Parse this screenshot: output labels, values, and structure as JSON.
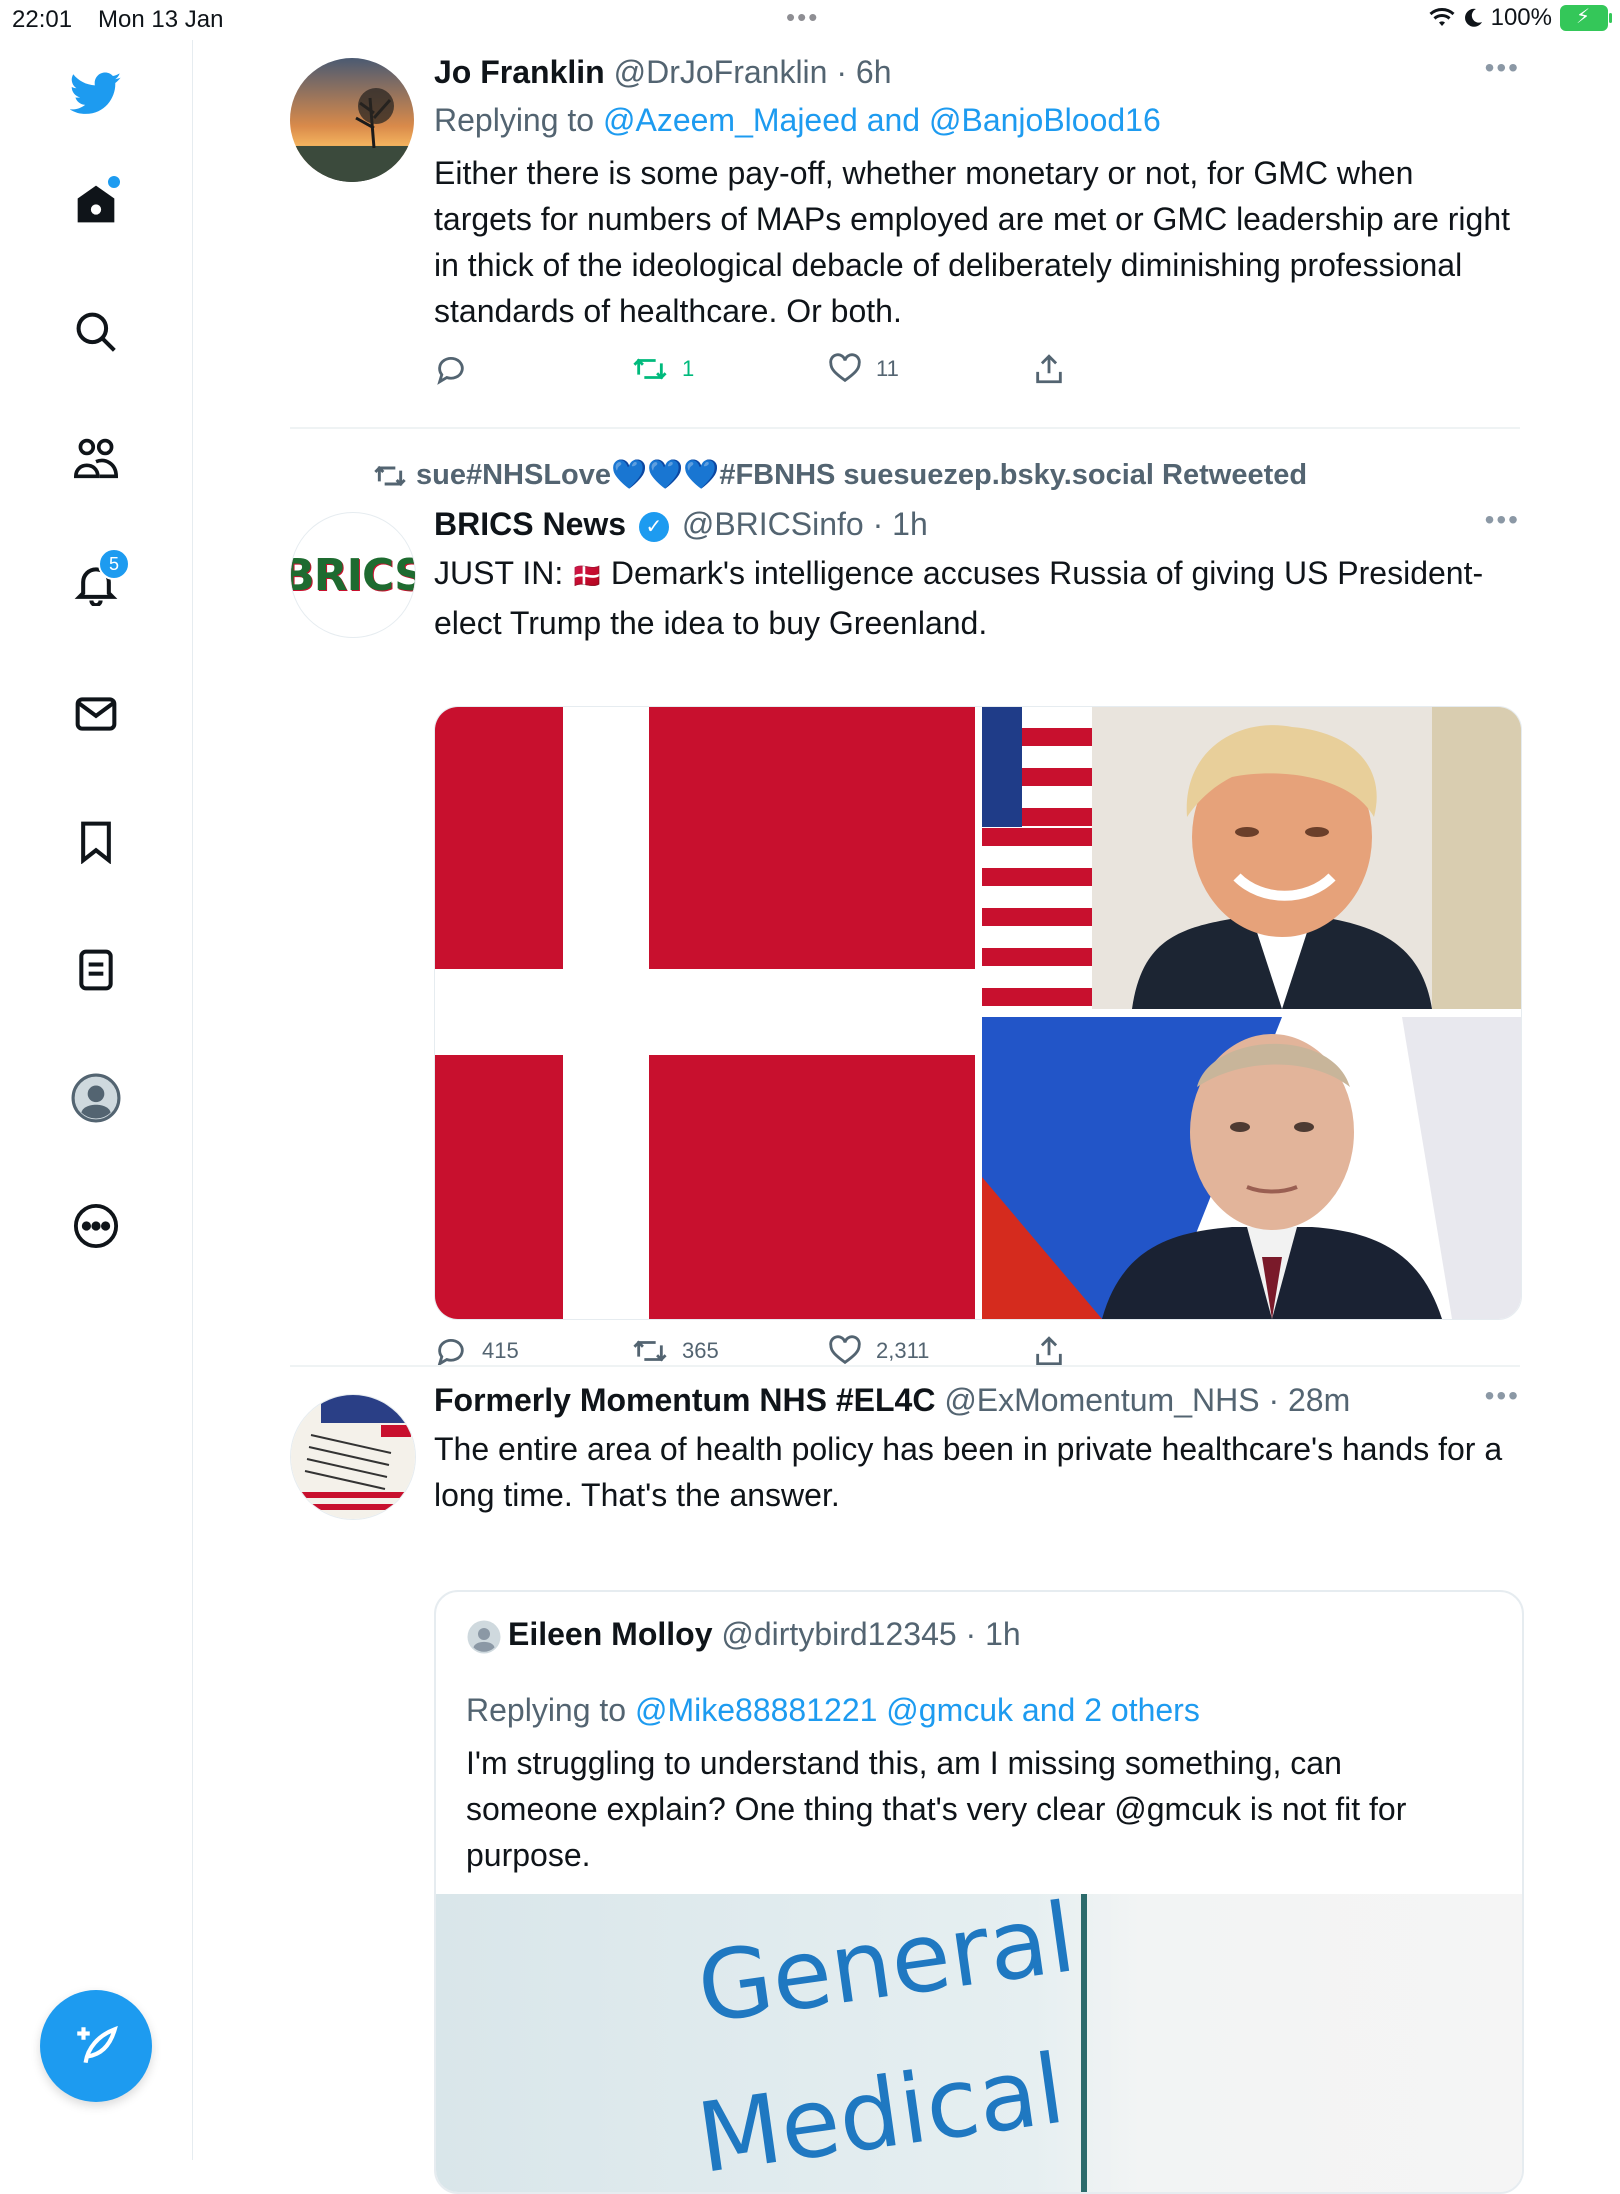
{
  "status_bar": {
    "time": "22:01",
    "date": "Mon 13 Jan",
    "battery": "100%"
  },
  "sidebar": {
    "notifications_badge": "5"
  },
  "tweets": [
    {
      "name": "Jo Franklin",
      "handle": "@DrJoFranklin",
      "time": "6h",
      "replying_prefix": "Replying to",
      "replying_to": "@Azeem_Majeed and @BanjoBlood16",
      "text": "Either there is some pay-off, whether monetary or not, for GMC when targets for numbers of MAPs employed are met or GMC leadership are right in thick of the ideological debacle of deliberately diminishing professional standards of healthcare. Or both.",
      "replies": "",
      "retweets": "1",
      "likes": "11"
    },
    {
      "retweeted_by": "sue#NHSLove💙💙💙#FBNHS suesuezep.bsky.social Retweeted",
      "name": "BRICS News",
      "handle": "@BRICSinfo",
      "time": "1h",
      "avatar_text": "BRICS",
      "text_prefix": "JUST IN: ",
      "flag": "🇩🇰",
      "text": " Demark's intelligence accuses Russia of giving US President-elect Trump the idea to buy Greenland.",
      "replies": "415",
      "retweets": "365",
      "likes": "2,311"
    },
    {
      "name": "Formerly Momentum NHS #EL4C",
      "handle": "@ExMomentum_NHS",
      "time": "28m",
      "text": "The entire area of health policy has been in private healthcare's hands for a long time. That's the answer.",
      "quote": {
        "name": "Eileen Molloy",
        "handle": "@dirtybird12345",
        "time": "1h",
        "replying_prefix": "Replying to",
        "replying_to": "@Mike88881221 @gmcuk and 2 others",
        "text": "I'm struggling to understand this, am I missing something, can someone explain?  One thing that's very clear @gmcuk is not fit for purpose.",
        "image_text_1": "General",
        "image_text_2": "Medical"
      }
    }
  ],
  "colors": {
    "accent": "#1d9bf0",
    "retweet_green": "#00ba7c",
    "danish_red": "#c8102e"
  }
}
